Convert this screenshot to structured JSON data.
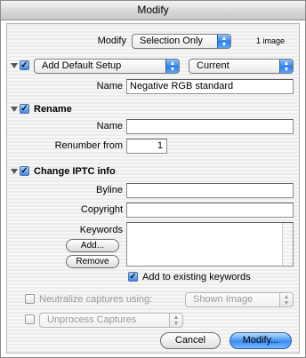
{
  "window": {
    "title": "Modify"
  },
  "modify_row": {
    "label": "Modify",
    "select_value": "Selection Only",
    "count_text": "1 image"
  },
  "setup": {
    "select_value": "Add Default Setup",
    "mode_value": "Current",
    "name_label": "Name",
    "name_value": "Negative RGB standard"
  },
  "rename": {
    "title": "Rename",
    "name_label": "Name",
    "name_value": "",
    "renumber_label": "Renumber from",
    "renumber_value": "1"
  },
  "iptc": {
    "title": "Change IPTC info",
    "byline_label": "Byline",
    "byline_value": "",
    "copyright_label": "Copyright",
    "copyright_value": "",
    "keywords_label": "Keywords",
    "add_label": "Add...",
    "remove_label": "Remove",
    "add_existing_label": "Add to existing keywords"
  },
  "neutralize": {
    "label": "Neutralize captures using:",
    "select_value": "Shown Image"
  },
  "unprocess": {
    "select_value": "Unprocess Captures"
  },
  "buttons": {
    "cancel": "Cancel",
    "ok": "Modify..."
  }
}
